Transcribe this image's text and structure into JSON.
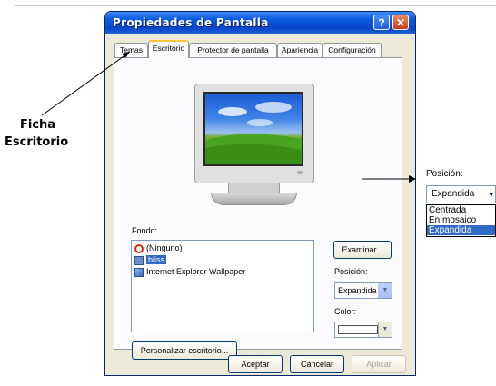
{
  "dialog": {
    "title": "Propiedades de Pantalla",
    "help_glyph": "?",
    "close_glyph": "✕",
    "tabs": [
      "Temas",
      "Escritorio",
      "Protector de pantalla",
      "Apariencia",
      "Configuración"
    ],
    "active_tab": "Escritorio",
    "fondo_label": "Fondo:",
    "background_list": [
      {
        "label": "(Ninguno)",
        "icon": "no-entry-icon"
      },
      {
        "label": "bliss",
        "icon": "image-file-icon",
        "selected": true
      },
      {
        "label": "Internet Explorer Wallpaper",
        "icon": "ie-wallpaper-icon"
      }
    ],
    "examinar_label": "Examinar...",
    "posicion_label": "Posición:",
    "posicion_value": "Expandida",
    "color_label": "Color:",
    "personalizar_label": "Personalizar escritorio...",
    "aceptar_label": "Aceptar",
    "cancelar_label": "Cancelar",
    "aplicar_label": "Aplicar"
  },
  "annotation": {
    "line1": "Ficha",
    "line2": "Escritorio"
  },
  "callout": {
    "label": "Posición:",
    "value": "Expandida",
    "options": [
      "Centrada",
      "En mosaico",
      "Expandida"
    ],
    "selected": "Expandida"
  },
  "colors": {
    "title_bar": "#0a5ae0",
    "selection": "#316ac5",
    "dialog_face": "#ece9d8",
    "tab_highlight": "#ffc83c"
  }
}
